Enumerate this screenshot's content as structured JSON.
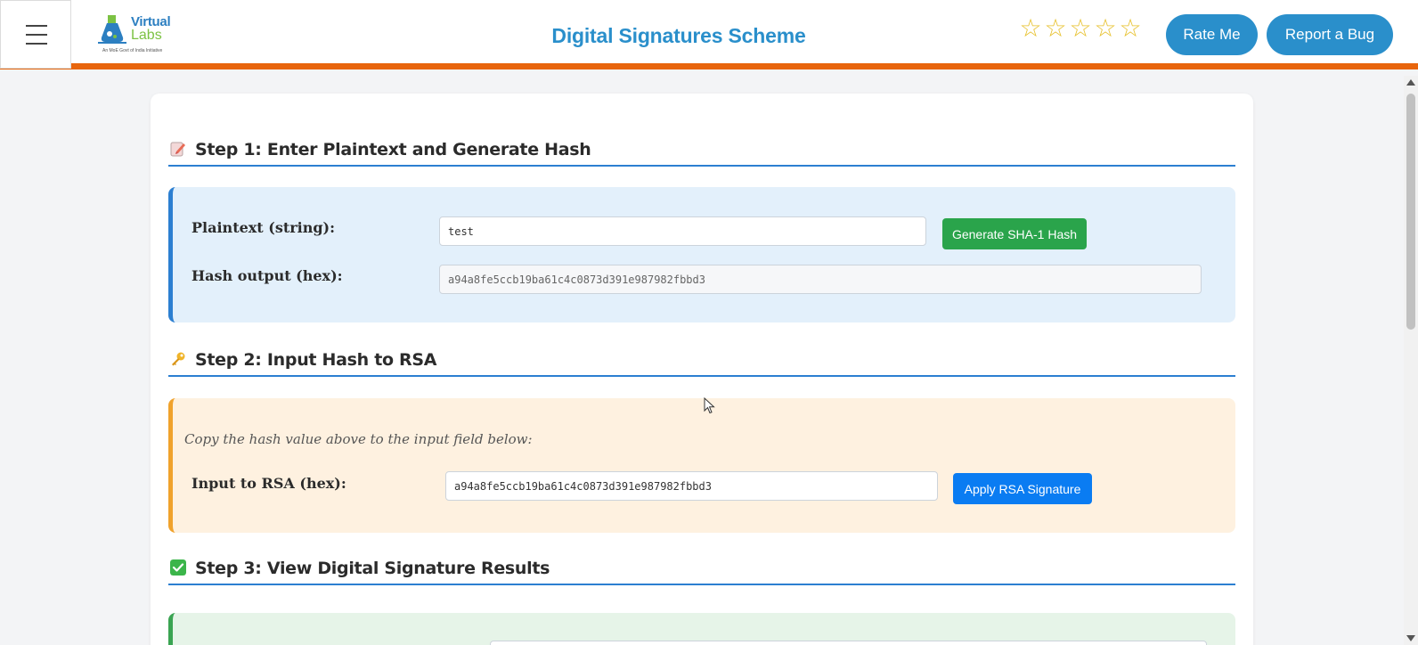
{
  "header": {
    "menu_icon": "hamburger-menu-icon",
    "logo": {
      "line1": "Virtual",
      "line2": "Labs",
      "tagline": "An MoE Govt of India Initiative"
    },
    "title": "Digital Signatures Scheme",
    "rating": {
      "max": 5,
      "value": 0,
      "icon": "star-outline-icon"
    },
    "rate_button": "Rate Me",
    "bug_button": "Report a Bug",
    "accent_color": "#e8650c",
    "brand_color": "#2a8fcb"
  },
  "steps": [
    {
      "title": "Step 1: Enter Plaintext and Generate Hash",
      "icon": "memo-pencil-icon",
      "plaintext_label": "Plaintext (string):",
      "plaintext_value": "test",
      "generate_button": "Generate SHA-1 Hash",
      "hash_label": "Hash output (hex):",
      "hash_value": "a94a8fe5ccb19ba61c4c0873d391e987982fbbd3"
    },
    {
      "title": "Step 2: Input Hash to RSA",
      "icon": "key-icon",
      "hint": "Copy the hash value above to the input field below:",
      "input_label": "Input to RSA (hex):",
      "input_value": "a94a8fe5ccb19ba61c4c0873d391e987982fbbd3",
      "apply_button": "Apply RSA Signature"
    },
    {
      "title": "Step 3: View Digital Signature Results",
      "icon": "check-mark-button-icon"
    }
  ],
  "colors": {
    "step_underline": "#2c7fd1",
    "step1_bg": "#e3f0fb",
    "step2_bg": "#fef1e0",
    "step3_bg": "#e6f4e8",
    "generate_button": "#2aa44b",
    "apply_button": "#0a7cf2"
  }
}
